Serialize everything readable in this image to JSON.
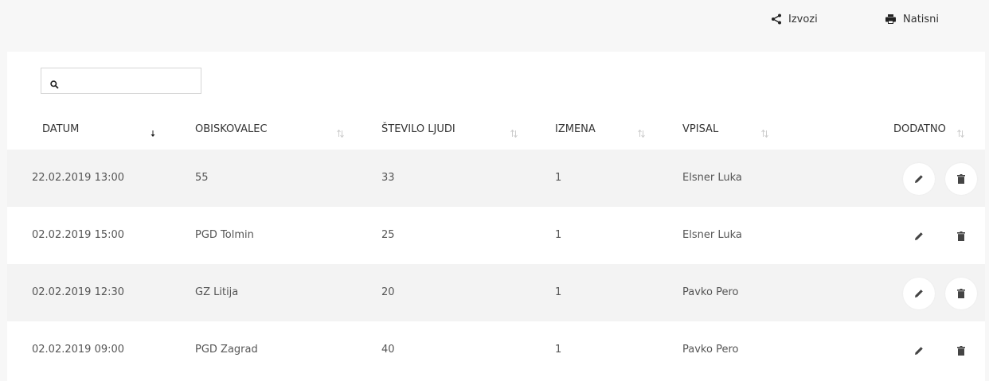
{
  "toolbar": {
    "export_label": "Izvozi",
    "print_label": "Natisni"
  },
  "search": {
    "value": "",
    "placeholder": ""
  },
  "table": {
    "columns": [
      {
        "label": "DATUM",
        "sort": "descending"
      },
      {
        "label": "OBISKOVALEC",
        "sort": "none"
      },
      {
        "label": "ŠTEVILO LJUDI",
        "sort": "none"
      },
      {
        "label": "IZMENA",
        "sort": "none"
      },
      {
        "label": "VPISAL",
        "sort": "none"
      },
      {
        "label": "DODATNO",
        "sort": "none"
      }
    ],
    "rows": [
      {
        "datum": "22.02.2019 13:00",
        "obiskovalec": "55",
        "stevilo": "33",
        "izmena": "1",
        "vpisal": "Elsner Luka"
      },
      {
        "datum": "02.02.2019 15:00",
        "obiskovalec": "PGD Tolmin",
        "stevilo": "25",
        "izmena": "1",
        "vpisal": "Elsner Luka"
      },
      {
        "datum": "02.02.2019 12:30",
        "obiskovalec": "GZ Litija",
        "stevilo": "20",
        "izmena": "1",
        "vpisal": "Pavko Pero"
      },
      {
        "datum": "02.02.2019 09:00",
        "obiskovalec": "PGD Zagrad",
        "stevilo": "40",
        "izmena": "1",
        "vpisal": "Pavko Pero"
      }
    ],
    "row_actions": [
      "pencil-icon",
      "trash-icon"
    ]
  },
  "colors": {
    "page_background": "#f7f7f7",
    "card_background": "#ffffff",
    "shaded_row": "#f3f3f3",
    "icon": "#444444"
  }
}
